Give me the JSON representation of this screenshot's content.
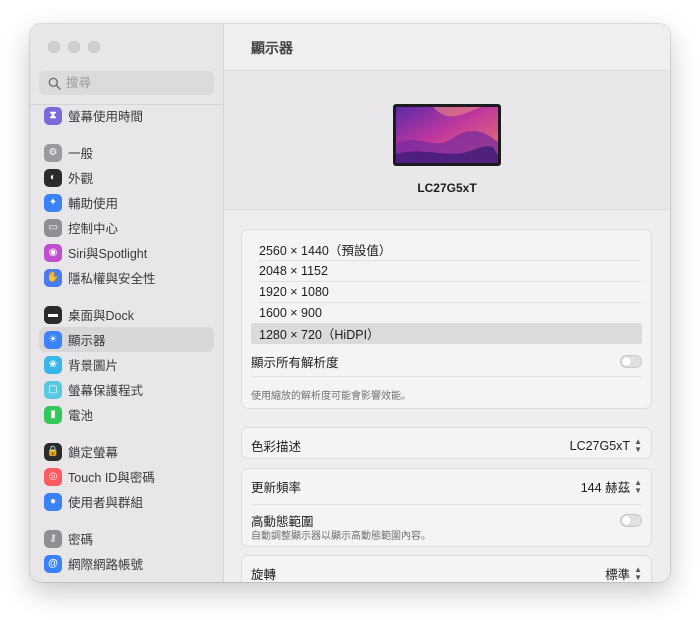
{
  "window": {
    "title": "顯示器"
  },
  "sidebar": {
    "search_placeholder": "搜尋",
    "groups": [
      [
        {
          "label": "螢幕使用時間",
          "icon": "hourglass-icon",
          "color": "#7a6bd8"
        }
      ],
      [
        {
          "label": "一般",
          "icon": "gear-icon",
          "color": "#9a9a9e"
        },
        {
          "label": "外觀",
          "icon": "appearance-icon",
          "color": "#2b2b2d"
        },
        {
          "label": "輔助使用",
          "icon": "accessibility-icon",
          "color": "#3b82f6"
        },
        {
          "label": "控制中心",
          "icon": "control-center-icon",
          "color": "#8e8e93"
        },
        {
          "label": "Siri與Spotlight",
          "icon": "siri-icon",
          "color": "#c04fd0"
        },
        {
          "label": "隱私權與安全性",
          "icon": "hand-icon",
          "color": "#4a7bf0"
        }
      ],
      [
        {
          "label": "桌面與Dock",
          "icon": "dock-icon",
          "color": "#2b2b2d"
        },
        {
          "label": "顯示器",
          "icon": "display-icon",
          "color": "#3b82f6",
          "active": true
        },
        {
          "label": "背景圖片",
          "icon": "wallpaper-icon",
          "color": "#38b6e8"
        },
        {
          "label": "螢幕保護程式",
          "icon": "screensaver-icon",
          "color": "#5ac8e0"
        },
        {
          "label": "電池",
          "icon": "battery-icon",
          "color": "#34c759"
        }
      ],
      [
        {
          "label": "鎖定螢幕",
          "icon": "lock-icon",
          "color": "#2b2b2d"
        },
        {
          "label": "Touch ID與密碼",
          "icon": "fingerprint-icon",
          "color": "#ff5a5f"
        },
        {
          "label": "使用者與群組",
          "icon": "users-icon",
          "color": "#3b82f6"
        }
      ],
      [
        {
          "label": "密碼",
          "icon": "key-icon",
          "color": "#8e8e93"
        },
        {
          "label": "網際網路帳號",
          "icon": "at-icon",
          "color": "#3b82f6"
        }
      ]
    ]
  },
  "display": {
    "name": "LC27G5xT"
  },
  "resolutions": {
    "options": [
      "2560 × 1440（預設值）",
      "2048 × 1152",
      "1920 × 1080",
      "1600 × 900",
      "1280 × 720（HiDPI）"
    ],
    "selected_index": 4,
    "show_all_label": "顯示所有解析度",
    "show_all_on": false,
    "hint": "使用縮放的解析度可能會影響效能。"
  },
  "color_profile": {
    "label": "色彩描述",
    "value": "LC27G5xT"
  },
  "refresh_rate": {
    "label": "更新頻率",
    "value": "144 赫茲"
  },
  "hdr": {
    "label": "高動態範圍",
    "description": "自動調整顯示器以顯示高動態範圍內容。",
    "on": false
  },
  "rotation": {
    "label": "旋轉",
    "value": "標準"
  },
  "colors": {
    "accent": "#3b82f6",
    "sidebar_bg": "#e8e6e8",
    "main_bg": "#efedef"
  }
}
